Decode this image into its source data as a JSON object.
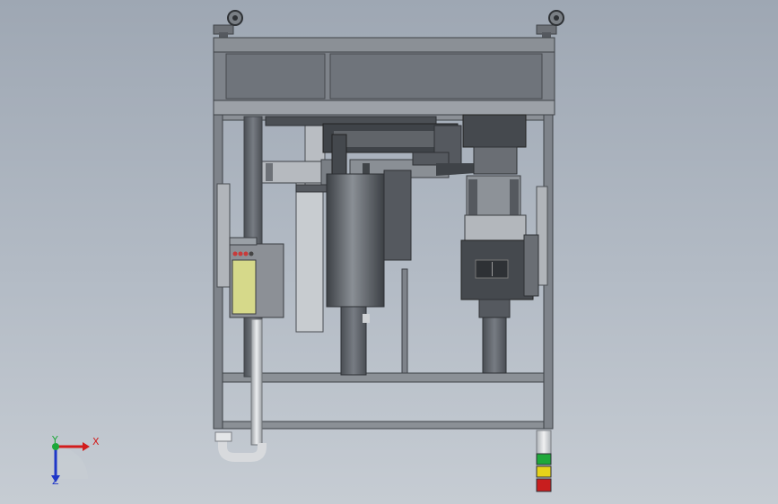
{
  "viewport": {
    "background_top": "#9ea7b3",
    "background_bottom": "#c6ccd3"
  },
  "model": {
    "frame_color": "#7e838a",
    "frame_edge": "#3e4247",
    "panel_color": "#6f747b",
    "dark_part": "#555a60",
    "darker_part": "#3f4348",
    "light_part": "#b9bdc2",
    "label_panel_color": "#d6d98a"
  },
  "signal_tower": {
    "lights": [
      {
        "name": "green",
        "color": "#1fa83a"
      },
      {
        "name": "yellow",
        "color": "#e6d21a"
      },
      {
        "name": "red",
        "color": "#c81e1e"
      }
    ]
  },
  "triad": {
    "x_label": "X",
    "y_label": "Y",
    "z_label": "Z",
    "x_color": "#d21c1c",
    "y_color": "#1ca83a",
    "z_color": "#1f37c8"
  }
}
